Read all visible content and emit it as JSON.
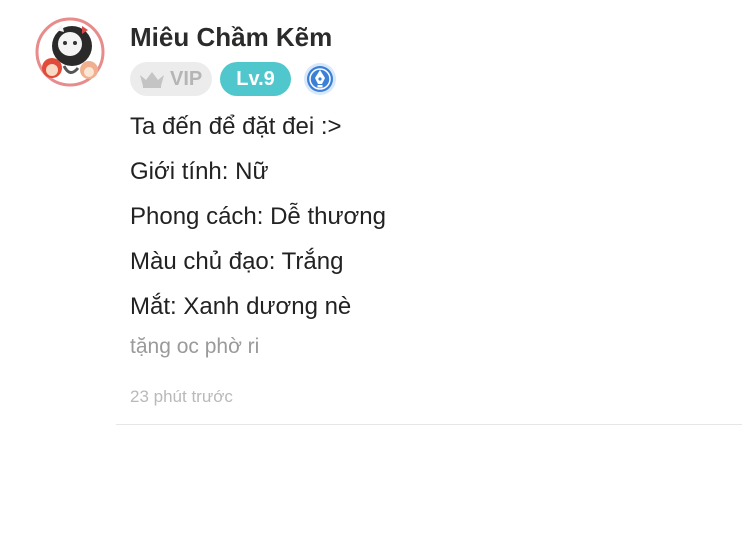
{
  "comment": {
    "username": "Miêu Chầm Kẽm",
    "badges": {
      "vip_label": "VIP",
      "level_label": "Lv.9",
      "vip_icon": "crown-icon",
      "pen_icon": "fountain-pen-icon"
    },
    "lines": [
      "Ta đến để đặt đei :>",
      "Giới tính: Nữ",
      "Phong cách: Dễ thương",
      "Màu chủ đạo: Trắng",
      "Mắt: Xanh dương nè"
    ],
    "tagline": "tặng oc phờ ri",
    "timestamp": "23 phút trước"
  },
  "colors": {
    "level_badge": "#4fc7cc",
    "vip_badge_bg": "#ececec",
    "pen_badge": "#3b7fd6",
    "divider": "#e6e6e6"
  }
}
